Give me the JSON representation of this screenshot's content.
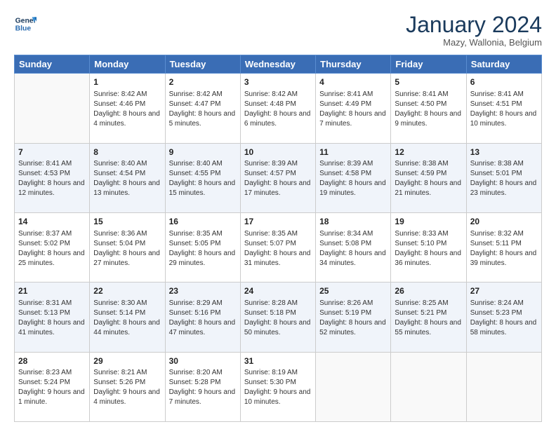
{
  "header": {
    "logo_general": "General",
    "logo_blue": "Blue",
    "month_title": "January 2024",
    "location": "Mazy, Wallonia, Belgium"
  },
  "weekdays": [
    "Sunday",
    "Monday",
    "Tuesday",
    "Wednesday",
    "Thursday",
    "Friday",
    "Saturday"
  ],
  "weeks": [
    [
      {
        "day": "",
        "sunrise": "",
        "sunset": "",
        "daylight": "",
        "empty": true
      },
      {
        "day": "1",
        "sunrise": "Sunrise: 8:42 AM",
        "sunset": "Sunset: 4:46 PM",
        "daylight": "Daylight: 8 hours and 4 minutes."
      },
      {
        "day": "2",
        "sunrise": "Sunrise: 8:42 AM",
        "sunset": "Sunset: 4:47 PM",
        "daylight": "Daylight: 8 hours and 5 minutes."
      },
      {
        "day": "3",
        "sunrise": "Sunrise: 8:42 AM",
        "sunset": "Sunset: 4:48 PM",
        "daylight": "Daylight: 8 hours and 6 minutes."
      },
      {
        "day": "4",
        "sunrise": "Sunrise: 8:41 AM",
        "sunset": "Sunset: 4:49 PM",
        "daylight": "Daylight: 8 hours and 7 minutes."
      },
      {
        "day": "5",
        "sunrise": "Sunrise: 8:41 AM",
        "sunset": "Sunset: 4:50 PM",
        "daylight": "Daylight: 8 hours and 9 minutes."
      },
      {
        "day": "6",
        "sunrise": "Sunrise: 8:41 AM",
        "sunset": "Sunset: 4:51 PM",
        "daylight": "Daylight: 8 hours and 10 minutes."
      }
    ],
    [
      {
        "day": "7",
        "sunrise": "Sunrise: 8:41 AM",
        "sunset": "Sunset: 4:53 PM",
        "daylight": "Daylight: 8 hours and 12 minutes."
      },
      {
        "day": "8",
        "sunrise": "Sunrise: 8:40 AM",
        "sunset": "Sunset: 4:54 PM",
        "daylight": "Daylight: 8 hours and 13 minutes."
      },
      {
        "day": "9",
        "sunrise": "Sunrise: 8:40 AM",
        "sunset": "Sunset: 4:55 PM",
        "daylight": "Daylight: 8 hours and 15 minutes."
      },
      {
        "day": "10",
        "sunrise": "Sunrise: 8:39 AM",
        "sunset": "Sunset: 4:57 PM",
        "daylight": "Daylight: 8 hours and 17 minutes."
      },
      {
        "day": "11",
        "sunrise": "Sunrise: 8:39 AM",
        "sunset": "Sunset: 4:58 PM",
        "daylight": "Daylight: 8 hours and 19 minutes."
      },
      {
        "day": "12",
        "sunrise": "Sunrise: 8:38 AM",
        "sunset": "Sunset: 4:59 PM",
        "daylight": "Daylight: 8 hours and 21 minutes."
      },
      {
        "day": "13",
        "sunrise": "Sunrise: 8:38 AM",
        "sunset": "Sunset: 5:01 PM",
        "daylight": "Daylight: 8 hours and 23 minutes."
      }
    ],
    [
      {
        "day": "14",
        "sunrise": "Sunrise: 8:37 AM",
        "sunset": "Sunset: 5:02 PM",
        "daylight": "Daylight: 8 hours and 25 minutes."
      },
      {
        "day": "15",
        "sunrise": "Sunrise: 8:36 AM",
        "sunset": "Sunset: 5:04 PM",
        "daylight": "Daylight: 8 hours and 27 minutes."
      },
      {
        "day": "16",
        "sunrise": "Sunrise: 8:35 AM",
        "sunset": "Sunset: 5:05 PM",
        "daylight": "Daylight: 8 hours and 29 minutes."
      },
      {
        "day": "17",
        "sunrise": "Sunrise: 8:35 AM",
        "sunset": "Sunset: 5:07 PM",
        "daylight": "Daylight: 8 hours and 31 minutes."
      },
      {
        "day": "18",
        "sunrise": "Sunrise: 8:34 AM",
        "sunset": "Sunset: 5:08 PM",
        "daylight": "Daylight: 8 hours and 34 minutes."
      },
      {
        "day": "19",
        "sunrise": "Sunrise: 8:33 AM",
        "sunset": "Sunset: 5:10 PM",
        "daylight": "Daylight: 8 hours and 36 minutes."
      },
      {
        "day": "20",
        "sunrise": "Sunrise: 8:32 AM",
        "sunset": "Sunset: 5:11 PM",
        "daylight": "Daylight: 8 hours and 39 minutes."
      }
    ],
    [
      {
        "day": "21",
        "sunrise": "Sunrise: 8:31 AM",
        "sunset": "Sunset: 5:13 PM",
        "daylight": "Daylight: 8 hours and 41 minutes."
      },
      {
        "day": "22",
        "sunrise": "Sunrise: 8:30 AM",
        "sunset": "Sunset: 5:14 PM",
        "daylight": "Daylight: 8 hours and 44 minutes."
      },
      {
        "day": "23",
        "sunrise": "Sunrise: 8:29 AM",
        "sunset": "Sunset: 5:16 PM",
        "daylight": "Daylight: 8 hours and 47 minutes."
      },
      {
        "day": "24",
        "sunrise": "Sunrise: 8:28 AM",
        "sunset": "Sunset: 5:18 PM",
        "daylight": "Daylight: 8 hours and 50 minutes."
      },
      {
        "day": "25",
        "sunrise": "Sunrise: 8:26 AM",
        "sunset": "Sunset: 5:19 PM",
        "daylight": "Daylight: 8 hours and 52 minutes."
      },
      {
        "day": "26",
        "sunrise": "Sunrise: 8:25 AM",
        "sunset": "Sunset: 5:21 PM",
        "daylight": "Daylight: 8 hours and 55 minutes."
      },
      {
        "day": "27",
        "sunrise": "Sunrise: 8:24 AM",
        "sunset": "Sunset: 5:23 PM",
        "daylight": "Daylight: 8 hours and 58 minutes."
      }
    ],
    [
      {
        "day": "28",
        "sunrise": "Sunrise: 8:23 AM",
        "sunset": "Sunset: 5:24 PM",
        "daylight": "Daylight: 9 hours and 1 minute."
      },
      {
        "day": "29",
        "sunrise": "Sunrise: 8:21 AM",
        "sunset": "Sunset: 5:26 PM",
        "daylight": "Daylight: 9 hours and 4 minutes."
      },
      {
        "day": "30",
        "sunrise": "Sunrise: 8:20 AM",
        "sunset": "Sunset: 5:28 PM",
        "daylight": "Daylight: 9 hours and 7 minutes."
      },
      {
        "day": "31",
        "sunrise": "Sunrise: 8:19 AM",
        "sunset": "Sunset: 5:30 PM",
        "daylight": "Daylight: 9 hours and 10 minutes."
      },
      {
        "day": "",
        "sunrise": "",
        "sunset": "",
        "daylight": "",
        "empty": true
      },
      {
        "day": "",
        "sunrise": "",
        "sunset": "",
        "daylight": "",
        "empty": true
      },
      {
        "day": "",
        "sunrise": "",
        "sunset": "",
        "daylight": "",
        "empty": true
      }
    ]
  ]
}
